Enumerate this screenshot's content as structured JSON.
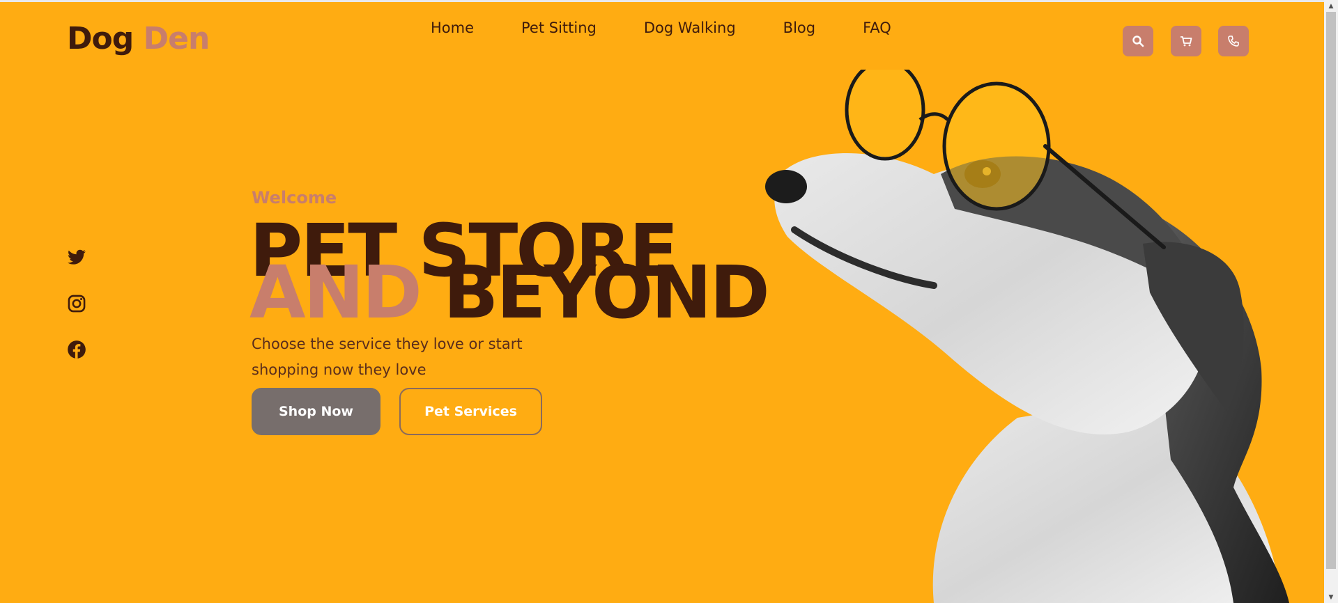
{
  "header": {
    "logo_part1": "Dog",
    "logo_part2": "Den",
    "nav": [
      "Home",
      "Pet Sitting",
      "Dog Walking",
      "Blog",
      "FAQ"
    ],
    "icons": [
      "search-icon",
      "cart-icon",
      "phone-icon"
    ]
  },
  "social": [
    "twitter-icon",
    "instagram-icon",
    "facebook-icon"
  ],
  "hero": {
    "welcome": "Welcome",
    "line1": "PET STORE",
    "line2a": "AND",
    "line2b": "BEYOND",
    "subtitle": "Choose the service they love or start shopping now they love",
    "primary_button": "Shop Now",
    "secondary_button": "Pet Services"
  },
  "colors": {
    "background": "#ffac12",
    "brand_dark": "#3f1b0c",
    "accent": "#c87e6c",
    "button_gray": "#776e6c"
  }
}
